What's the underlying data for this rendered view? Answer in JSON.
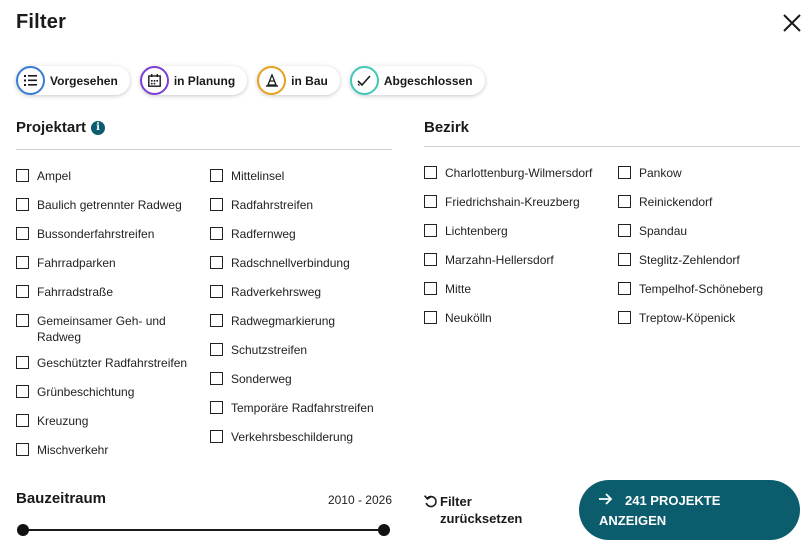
{
  "header": {
    "title": "Filter",
    "close_icon": "close-icon"
  },
  "status_chips": [
    {
      "label": "Vorgesehen",
      "color": "#3a7bd5",
      "icon": "list-icon"
    },
    {
      "label": "in Planung",
      "color": "#7b3fd6",
      "icon": "calendar-icon"
    },
    {
      "label": "in Bau",
      "color": "#e6a020",
      "icon": "traffic-cone-icon"
    },
    {
      "label": "Abgeschlossen",
      "color": "#3fc7b7",
      "icon": "check-icon"
    }
  ],
  "projektart": {
    "title": "Projektart",
    "info_icon": "i",
    "left": [
      "Ampel",
      "Baulich getrennter Radweg",
      "Bussonderfahrstreifen",
      "Fahrradparken",
      "Fahrradstraße",
      "Gemeinsamer Geh- und Radweg",
      "Geschützter Radfahrstreifen",
      "Grünbeschichtung",
      "Kreuzung",
      "Mischverkehr"
    ],
    "right": [
      "Mittelinsel",
      "Radfahrstreifen",
      "Radfernweg",
      "Radschnellverbindung",
      "Radverkehrsweg",
      "Radwegmarkierung",
      "Schutzstreifen",
      "Sonderweg",
      "Temporäre Radfahrstreifen",
      "Verkehrsbeschilderung"
    ]
  },
  "bezirk": {
    "title": "Bezirk",
    "left": [
      "Charlottenburg-Wilmersdorf",
      "Friedrichshain-Kreuzberg",
      "Lichtenberg",
      "Marzahn-Hellersdorf",
      "Mitte",
      "Neukölln"
    ],
    "right": [
      "Pankow",
      "Reinickendorf",
      "Spandau",
      "Steglitz-Zehlendorf",
      "Tempelhof-Schöneberg",
      "Treptow-Köpenick"
    ]
  },
  "bauzeitraum": {
    "title": "Bauzeitraum",
    "range": "2010 - 2026"
  },
  "actions": {
    "reset_label_1": "Filter",
    "reset_label_2": "zurücksetzen",
    "cta_label_1": "241 PROJEKTE",
    "cta_label_2": "ANZEIGEN"
  },
  "colors": {
    "accent": "#0b5d6e"
  }
}
